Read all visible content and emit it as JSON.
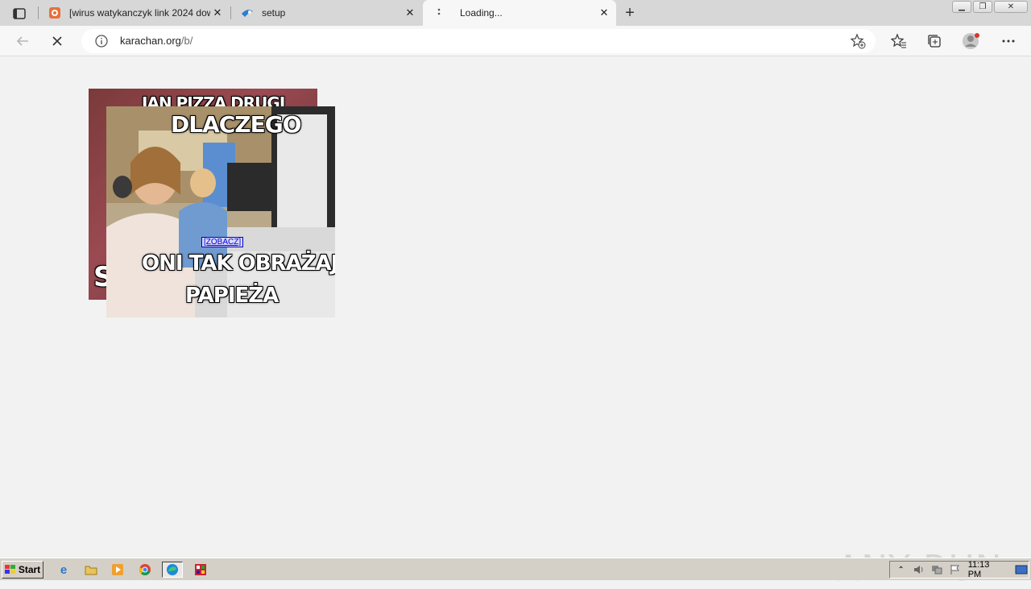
{
  "browser": {
    "tabs": [
      {
        "title": "[wirus watykanczyk link 2024 dow",
        "icon": "karachan-favicon",
        "active": false
      },
      {
        "title": "setup",
        "icon": "setup-favicon",
        "active": false
      },
      {
        "title": "Loading...",
        "icon": "loading-icon",
        "active": true
      }
    ],
    "address": {
      "host": "karachan.org",
      "path": "/b/"
    }
  },
  "page": {
    "meme_back": {
      "top_text": "JAN PIZZA DRUGI",
      "side_text": "S"
    },
    "meme_front": {
      "top_text": "DLACZEGO",
      "bottom_text_1": "ONI TAK OBRAŻAJĄ",
      "bottom_text_2": "PAPIEŻA",
      "link_text": "[ZOBACZ]"
    }
  },
  "watermark": {
    "text": "ANY RUN"
  },
  "taskbar": {
    "start_label": "Start",
    "clock": "11:13 PM"
  }
}
